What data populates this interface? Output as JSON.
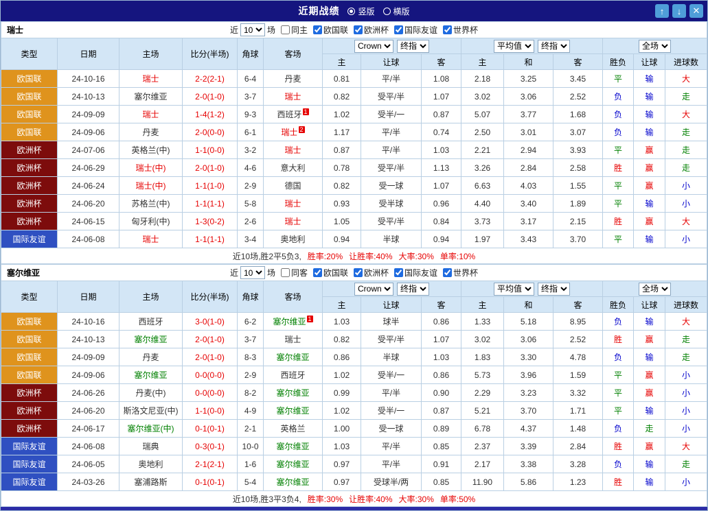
{
  "titlebar": {
    "title": "近期战绩",
    "view_options": [
      {
        "label": "竖版",
        "selected": true
      },
      {
        "label": "横版",
        "selected": false
      }
    ],
    "up_button": "↑",
    "down_button": "↓",
    "close_button": "✕"
  },
  "headers": {
    "type": "类型",
    "date": "日期",
    "home": "主场",
    "score": "比分(半场)",
    "corners": "角球",
    "away": "客场",
    "odds_group": {
      "bookmaker": "Crown",
      "final": "终指",
      "home": "主",
      "handicap": "让球",
      "away": "客"
    },
    "avg_group": {
      "label": "平均值",
      "final": "终指",
      "home": "主",
      "draw": "和",
      "away": "客"
    },
    "result_group": {
      "scope": "全场",
      "result": "胜负",
      "handicap": "让球",
      "goals": "进球数"
    }
  },
  "type_colors": {
    "欧国联": "#df931d",
    "欧洲杯": "#7d0c0c",
    "国际友谊": "#2f50c1"
  },
  "value_colors": {
    "胜": "#e60000",
    "平": "#008000",
    "负": "#0000cc",
    "赢": "#e60000",
    "输": "#0000cc",
    "走": "#008000",
    "大": "#e60000",
    "小": "#0000cc"
  },
  "sections": [
    {
      "team": "瑞士",
      "focus_color": "#e60000",
      "filters": {
        "prefix": "近",
        "count": "10",
        "suffix": "场",
        "same": {
          "label": "同主",
          "checked": false
        },
        "leagues": [
          {
            "label": "欧国联",
            "checked": true
          },
          {
            "label": "欧洲杯",
            "checked": true
          },
          {
            "label": "国际友谊",
            "checked": true
          },
          {
            "label": "世界杯",
            "checked": true
          }
        ]
      },
      "rows": [
        {
          "type": "欧国联",
          "date": "24-10-16",
          "home": "瑞士",
          "home_focus": true,
          "home_badge": "",
          "score": "2-2(2-1)",
          "corners": "6-4",
          "away": "丹麦",
          "away_focus": false,
          "away_badge": "",
          "odds": [
            "0.81",
            "平/半",
            "1.08"
          ],
          "avg": [
            "2.18",
            "3.25",
            "3.45"
          ],
          "result": "平",
          "handicap": "输",
          "goals": "大"
        },
        {
          "type": "欧国联",
          "date": "24-10-13",
          "home": "塞尔维亚",
          "home_focus": false,
          "home_badge": "",
          "score": "2-0(1-0)",
          "corners": "3-7",
          "away": "瑞士",
          "away_focus": true,
          "away_badge": "",
          "odds": [
            "0.82",
            "受平/半",
            "1.07"
          ],
          "avg": [
            "3.02",
            "3.06",
            "2.52"
          ],
          "result": "负",
          "handicap": "输",
          "goals": "走"
        },
        {
          "type": "欧国联",
          "date": "24-09-09",
          "home": "瑞士",
          "home_focus": true,
          "home_badge": "",
          "score": "1-4(1-2)",
          "corners": "9-3",
          "away": "西班牙",
          "away_focus": false,
          "away_badge": "1",
          "odds": [
            "1.02",
            "受半/一",
            "0.87"
          ],
          "avg": [
            "5.07",
            "3.77",
            "1.68"
          ],
          "result": "负",
          "handicap": "输",
          "goals": "大"
        },
        {
          "type": "欧国联",
          "date": "24-09-06",
          "home": "丹麦",
          "home_focus": false,
          "home_badge": "",
          "score": "2-0(0-0)",
          "corners": "6-1",
          "away": "瑞士",
          "away_focus": true,
          "away_badge": "2",
          "odds": [
            "1.17",
            "平/半",
            "0.74"
          ],
          "avg": [
            "2.50",
            "3.01",
            "3.07"
          ],
          "result": "负",
          "handicap": "输",
          "goals": "走"
        },
        {
          "type": "欧洲杯",
          "date": "24-07-06",
          "home": "英格兰(中)",
          "home_focus": false,
          "home_badge": "",
          "score": "1-1(0-0)",
          "corners": "3-2",
          "away": "瑞士",
          "away_focus": true,
          "away_badge": "",
          "odds": [
            "0.87",
            "平/半",
            "1.03"
          ],
          "avg": [
            "2.21",
            "2.94",
            "3.93"
          ],
          "result": "平",
          "handicap": "赢",
          "goals": "走"
        },
        {
          "type": "欧洲杯",
          "date": "24-06-29",
          "home": "瑞士(中)",
          "home_focus": true,
          "home_badge": "",
          "score": "2-0(1-0)",
          "corners": "4-6",
          "away": "意大利",
          "away_focus": false,
          "away_badge": "",
          "odds": [
            "0.78",
            "受平/半",
            "1.13"
          ],
          "avg": [
            "3.26",
            "2.84",
            "2.58"
          ],
          "result": "胜",
          "handicap": "赢",
          "goals": "走"
        },
        {
          "type": "欧洲杯",
          "date": "24-06-24",
          "home": "瑞士(中)",
          "home_focus": true,
          "home_badge": "",
          "score": "1-1(1-0)",
          "corners": "2-9",
          "away": "德国",
          "away_focus": false,
          "away_badge": "",
          "odds": [
            "0.82",
            "受一球",
            "1.07"
          ],
          "avg": [
            "6.63",
            "4.03",
            "1.55"
          ],
          "result": "平",
          "handicap": "赢",
          "goals": "小"
        },
        {
          "type": "欧洲杯",
          "date": "24-06-20",
          "home": "苏格兰(中)",
          "home_focus": false,
          "home_badge": "",
          "score": "1-1(1-1)",
          "corners": "5-8",
          "away": "瑞士",
          "away_focus": true,
          "away_badge": "",
          "odds": [
            "0.93",
            "受半球",
            "0.96"
          ],
          "avg": [
            "4.40",
            "3.40",
            "1.89"
          ],
          "result": "平",
          "handicap": "输",
          "goals": "小"
        },
        {
          "type": "欧洲杯",
          "date": "24-06-15",
          "home": "匈牙利(中)",
          "home_focus": false,
          "home_badge": "",
          "score": "1-3(0-2)",
          "corners": "2-6",
          "away": "瑞士",
          "away_focus": true,
          "away_badge": "",
          "odds": [
            "1.05",
            "受平/半",
            "0.84"
          ],
          "avg": [
            "3.73",
            "3.17",
            "2.15"
          ],
          "result": "胜",
          "handicap": "赢",
          "goals": "大"
        },
        {
          "type": "国际友谊",
          "date": "24-06-08",
          "home": "瑞士",
          "home_focus": true,
          "home_badge": "",
          "score": "1-1(1-1)",
          "corners": "3-4",
          "away": "奥地利",
          "away_focus": false,
          "away_badge": "",
          "odds": [
            "0.94",
            "半球",
            "0.94"
          ],
          "avg": [
            "1.97",
            "3.43",
            "3.70"
          ],
          "result": "平",
          "handicap": "输",
          "goals": "小"
        }
      ],
      "summary": {
        "lead": "近10场,胜2平5负3,",
        "stats": [
          "胜率:20%",
          "让胜率:40%",
          "大率:30%",
          "单率:10%"
        ]
      }
    },
    {
      "team": "塞尔维亚",
      "focus_color": "#008000",
      "filters": {
        "prefix": "近",
        "count": "10",
        "suffix": "场",
        "same": {
          "label": "同客",
          "checked": false
        },
        "leagues": [
          {
            "label": "欧国联",
            "checked": true
          },
          {
            "label": "欧洲杯",
            "checked": true
          },
          {
            "label": "国际友谊",
            "checked": true
          },
          {
            "label": "世界杯",
            "checked": true
          }
        ]
      },
      "rows": [
        {
          "type": "欧国联",
          "date": "24-10-16",
          "home": "西班牙",
          "home_focus": false,
          "home_badge": "",
          "score": "3-0(1-0)",
          "corners": "6-2",
          "away": "塞尔维亚",
          "away_focus": true,
          "away_badge": "1",
          "odds": [
            "1.03",
            "球半",
            "0.86"
          ],
          "avg": [
            "1.33",
            "5.18",
            "8.95"
          ],
          "result": "负",
          "handicap": "输",
          "goals": "大"
        },
        {
          "type": "欧国联",
          "date": "24-10-13",
          "home": "塞尔维亚",
          "home_focus": true,
          "home_badge": "",
          "score": "2-0(1-0)",
          "corners": "3-7",
          "away": "瑞士",
          "away_focus": false,
          "away_badge": "",
          "odds": [
            "0.82",
            "受平/半",
            "1.07"
          ],
          "avg": [
            "3.02",
            "3.06",
            "2.52"
          ],
          "result": "胜",
          "handicap": "赢",
          "goals": "走"
        },
        {
          "type": "欧国联",
          "date": "24-09-09",
          "home": "丹麦",
          "home_focus": false,
          "home_badge": "",
          "score": "2-0(1-0)",
          "corners": "8-3",
          "away": "塞尔维亚",
          "away_focus": true,
          "away_badge": "",
          "odds": [
            "0.86",
            "半球",
            "1.03"
          ],
          "avg": [
            "1.83",
            "3.30",
            "4.78"
          ],
          "result": "负",
          "handicap": "输",
          "goals": "走"
        },
        {
          "type": "欧国联",
          "date": "24-09-06",
          "home": "塞尔维亚",
          "home_focus": true,
          "home_badge": "",
          "score": "0-0(0-0)",
          "corners": "2-9",
          "away": "西班牙",
          "away_focus": false,
          "away_badge": "",
          "odds": [
            "1.02",
            "受半/一",
            "0.86"
          ],
          "avg": [
            "5.73",
            "3.96",
            "1.59"
          ],
          "result": "平",
          "handicap": "赢",
          "goals": "小"
        },
        {
          "type": "欧洲杯",
          "date": "24-06-26",
          "home": "丹麦(中)",
          "home_focus": false,
          "home_badge": "",
          "score": "0-0(0-0)",
          "corners": "8-2",
          "away": "塞尔维亚",
          "away_focus": true,
          "away_badge": "",
          "odds": [
            "0.99",
            "平/半",
            "0.90"
          ],
          "avg": [
            "2.29",
            "3.23",
            "3.32"
          ],
          "result": "平",
          "handicap": "赢",
          "goals": "小"
        },
        {
          "type": "欧洲杯",
          "date": "24-06-20",
          "home": "斯洛文尼亚(中)",
          "home_focus": false,
          "home_badge": "",
          "score": "1-1(0-0)",
          "corners": "4-9",
          "away": "塞尔维亚",
          "away_focus": true,
          "away_badge": "",
          "odds": [
            "1.02",
            "受半/一",
            "0.87"
          ],
          "avg": [
            "5.21",
            "3.70",
            "1.71"
          ],
          "result": "平",
          "handicap": "输",
          "goals": "小"
        },
        {
          "type": "欧洲杯",
          "date": "24-06-17",
          "home": "塞尔维亚(中)",
          "home_focus": true,
          "home_badge": "",
          "score": "0-1(0-1)",
          "corners": "2-1",
          "away": "英格兰",
          "away_focus": false,
          "away_badge": "",
          "odds": [
            "1.00",
            "受一球",
            "0.89"
          ],
          "avg": [
            "6.78",
            "4.37",
            "1.48"
          ],
          "result": "负",
          "handicap": "走",
          "goals": "小"
        },
        {
          "type": "国际友谊",
          "date": "24-06-08",
          "home": "瑞典",
          "home_focus": false,
          "home_badge": "",
          "score": "0-3(0-1)",
          "corners": "10-0",
          "away": "塞尔维亚",
          "away_focus": true,
          "away_badge": "",
          "odds": [
            "1.03",
            "平/半",
            "0.85"
          ],
          "avg": [
            "2.37",
            "3.39",
            "2.84"
          ],
          "result": "胜",
          "handicap": "赢",
          "goals": "大"
        },
        {
          "type": "国际友谊",
          "date": "24-06-05",
          "home": "奥地利",
          "home_focus": false,
          "home_badge": "",
          "score": "2-1(2-1)",
          "corners": "1-6",
          "away": "塞尔维亚",
          "away_focus": true,
          "away_badge": "",
          "odds": [
            "0.97",
            "平/半",
            "0.91"
          ],
          "avg": [
            "2.17",
            "3.38",
            "3.28"
          ],
          "result": "负",
          "handicap": "输",
          "goals": "走"
        },
        {
          "type": "国际友谊",
          "date": "24-03-26",
          "home": "塞浦路斯",
          "home_focus": false,
          "home_badge": "",
          "score": "0-1(0-1)",
          "corners": "5-4",
          "away": "塞尔维亚",
          "away_focus": true,
          "away_badge": "",
          "odds": [
            "0.97",
            "受球半/两",
            "0.85"
          ],
          "avg": [
            "11.90",
            "5.86",
            "1.23"
          ],
          "result": "胜",
          "handicap": "输",
          "goals": "小"
        }
      ],
      "summary": {
        "lead": "近10场,胜3平3负4,",
        "stats": [
          "胜率:30%",
          "让胜率:40%",
          "大率:30%",
          "单率:50%"
        ]
      }
    }
  ]
}
